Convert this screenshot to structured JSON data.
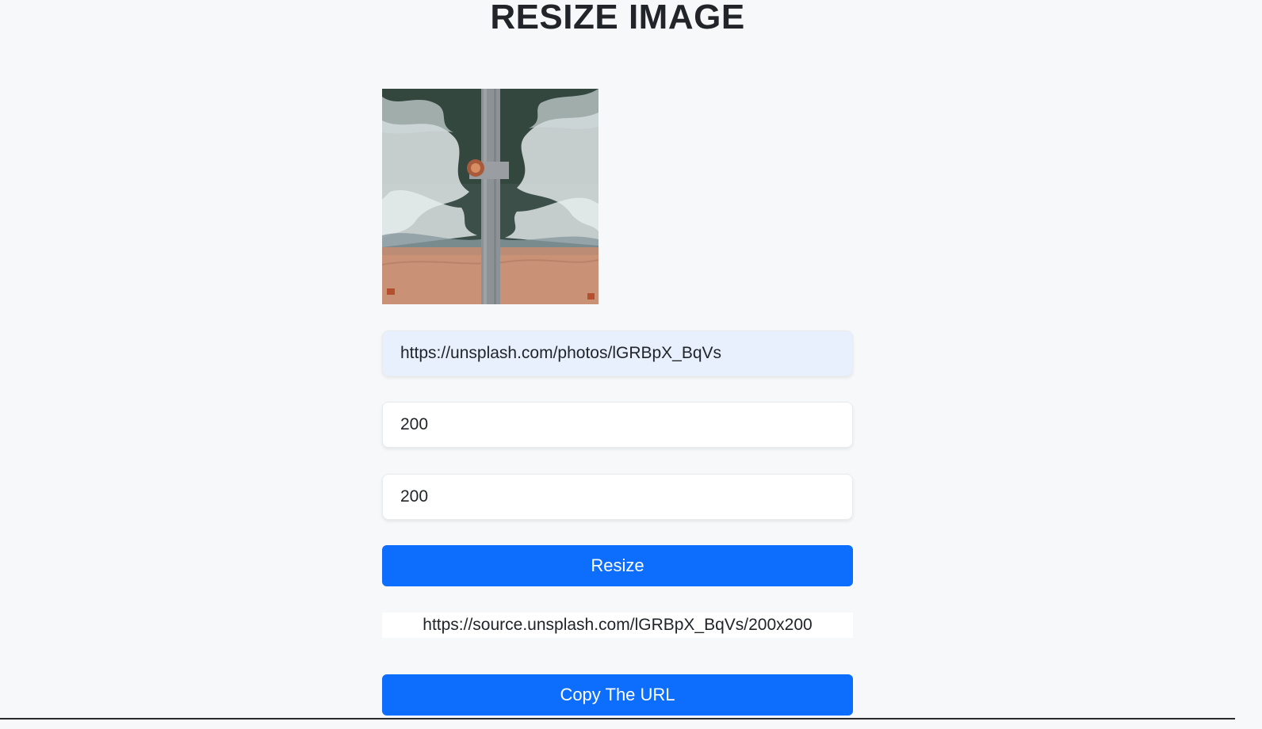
{
  "page": {
    "title": "RESIZE IMAGE"
  },
  "preview": {
    "alt_icon": "aerial-pier-beach-image"
  },
  "form": {
    "url_value": "https://unsplash.com/photos/lGRBpX_BqVs",
    "width_value": "200",
    "height_value": "200",
    "resize_label": "Resize",
    "result_url": "https://source.unsplash.com/lGRBpX_BqVs/200x200",
    "copy_label": "Copy The URL"
  },
  "colors": {
    "background": "#f7f8fa",
    "primary_button": "#0d6efd",
    "autofill_field": "#e8f0fe"
  }
}
